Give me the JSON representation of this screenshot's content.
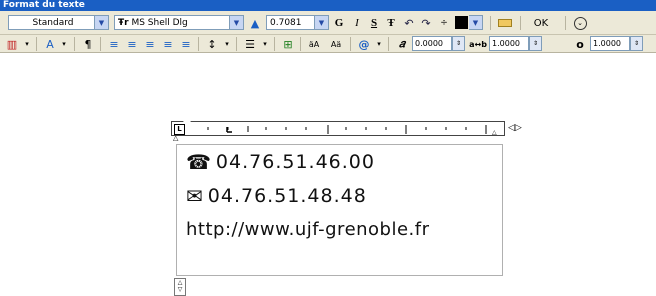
{
  "toolbar": {
    "title": "Format du texte",
    "style_value": "Standard",
    "font_value": "MS Shell Dlg",
    "font_prefix": "Ŧr",
    "height_value": "0.7081",
    "bold_label": "G",
    "italic_label": "I",
    "underline_label": "S",
    "overline_label": "Ŧ",
    "ok_label": "OK",
    "oblique_value": "0.0000",
    "tracking_value": "1.0000",
    "width_value": "1.0000",
    "color_swatch": "#000000"
  },
  "editor": {
    "lines": [
      {
        "icon": "telephone-icon",
        "text": "04.76.51.46.00"
      },
      {
        "icon": "envelope-icon",
        "text": "04.76.51.48.48"
      },
      {
        "icon": "",
        "text": "http://www.ujf-grenoble.fr"
      }
    ]
  },
  "colors": {
    "titlebar": "#1a5fc4",
    "toolbar_bg": "#ece9d8"
  }
}
